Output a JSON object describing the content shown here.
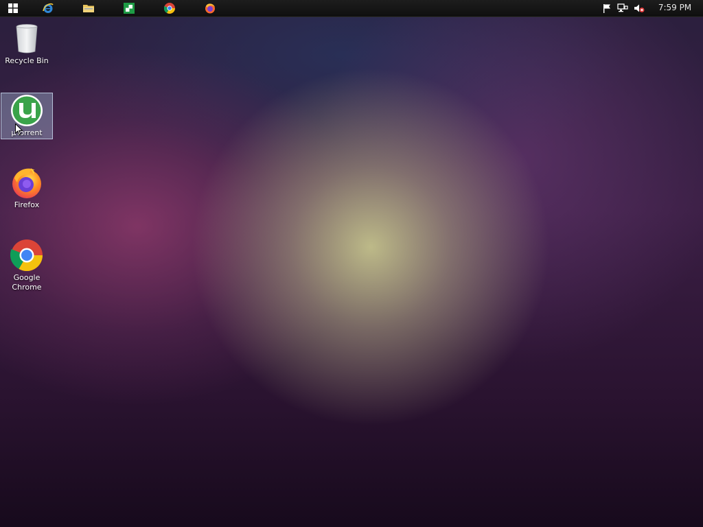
{
  "taskbar": {
    "pinned": [
      {
        "name": "start-button",
        "icon": "windows-logo-icon"
      },
      {
        "name": "internet-explorer",
        "icon": "internet-explorer-icon"
      },
      {
        "name": "file-explorer",
        "icon": "folder-icon"
      },
      {
        "name": "excel",
        "icon": "excel-icon"
      },
      {
        "name": "chrome",
        "icon": "chrome-icon"
      },
      {
        "name": "firefox",
        "icon": "firefox-icon"
      }
    ],
    "tray": {
      "icons": [
        "flag-icon",
        "network-icon",
        "volume-muted-icon"
      ],
      "clock": "7:59 PM"
    }
  },
  "desktop": {
    "icons": [
      {
        "label": "Recycle Bin",
        "icon": "recycle-bin-icon",
        "selected": false
      },
      {
        "label": "µTorrent",
        "icon": "utorrent-icon",
        "selected": true
      },
      {
        "label": "Firefox",
        "icon": "firefox-icon",
        "selected": false
      },
      {
        "label": "Google Chrome",
        "icon": "chrome-icon",
        "selected": false
      }
    ]
  },
  "colors": {
    "taskbar": "#141414",
    "selection": "#96aac8",
    "utorrent_green": "#3aa34a"
  }
}
